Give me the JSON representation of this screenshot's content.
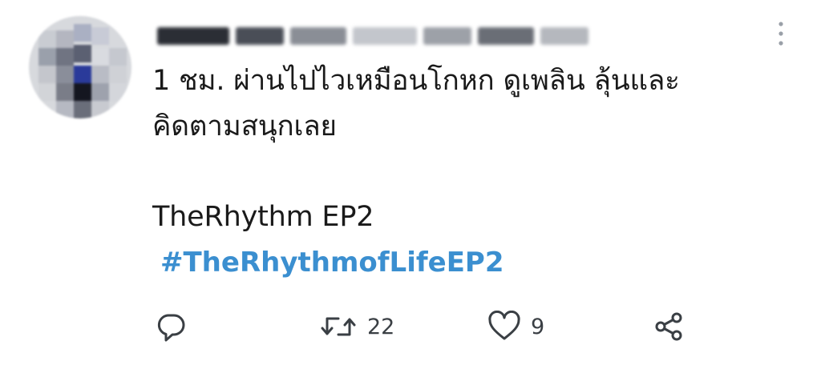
{
  "tweet": {
    "text_line_1": "1 ชม. ผ่านไปไวเหมือนโกหก ดูเพลิน ลุ้นและ",
    "text_line_2": "คิดตามสนุกเลย",
    "text_line_3": "TheRhythm EP2",
    "hashtag": "#TheRhythmofLifeEP2",
    "hashtag_color": "#3b8fd0"
  },
  "actions": {
    "reply": {
      "icon": "reply-icon"
    },
    "retweet": {
      "icon": "retweet-icon",
      "count": "22"
    },
    "like": {
      "icon": "heart-icon",
      "count": "9"
    },
    "share": {
      "icon": "share-icon"
    }
  },
  "header": {
    "more_icon": "more-vertical-icon"
  },
  "colors": {
    "text": "#1a1a1a",
    "icon": "#3a3f44",
    "link": "#3b8fd0"
  }
}
